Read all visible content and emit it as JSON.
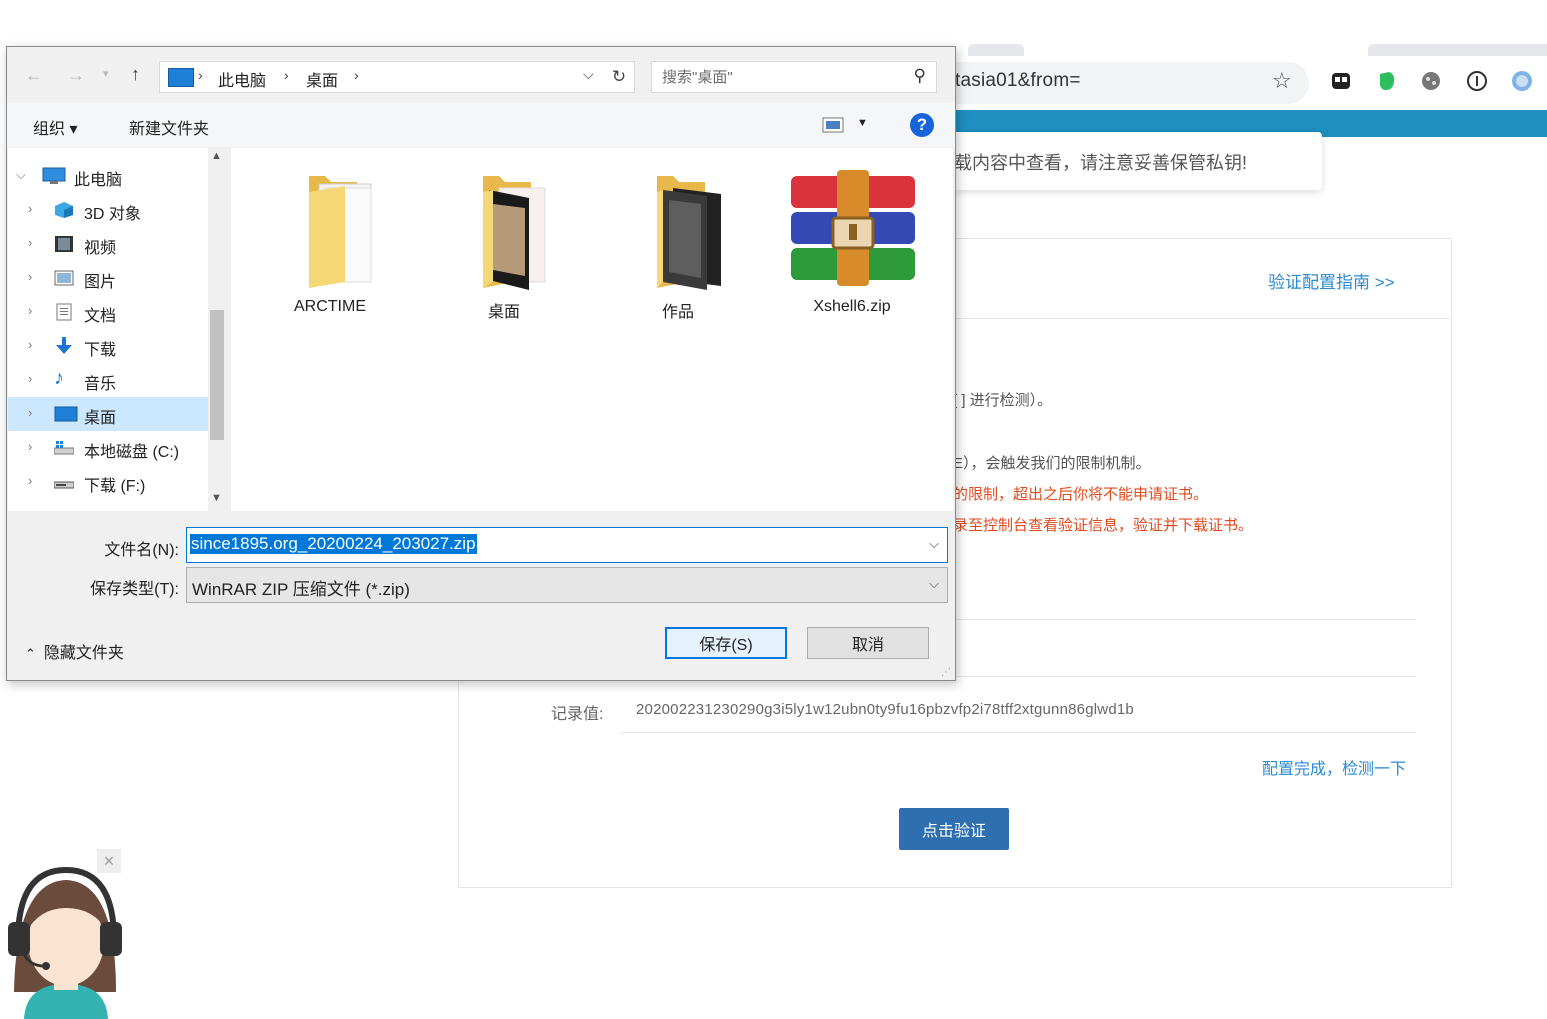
{
  "browser": {
    "url_fragment": "tasia01&from=",
    "toast": "下载内容中查看，请注意妥善保管私钥!",
    "guide_link": "验证配置指南 >>",
    "lines": [
      {
        "text": "[ ] 进行检测）。",
        "color": "#555555"
      },
      {
        "text": "E），会触发我们的限制机制。",
        "color": "#555555"
      },
      {
        "text": "的限制，超出之后你将不能申请证书。",
        "color": "#e04a1f"
      },
      {
        "text": "录至控制台查看验证信息，验证并下载证书。",
        "color": "#e04a1f"
      }
    ],
    "record_label": "记录值:",
    "record_value": "202002231230290g3i5ly1w12ubn0ty9fu16pbzvfp2i78tff2xtgunn86glwd1b",
    "done_link": "配置完成，检测一下",
    "verify_button": "点击验证"
  },
  "dialog": {
    "breadcrumb": [
      "此电脑",
      "桌面"
    ],
    "search_placeholder": "搜索\"桌面\"",
    "toolbar": {
      "organize": "组织 ▾",
      "new_folder": "新建文件夹"
    },
    "tree": [
      {
        "label": "此电脑",
        "icon": "computer-icon",
        "expanded": true
      },
      {
        "label": "3D 对象",
        "icon": "cube-3d-icon"
      },
      {
        "label": "视频",
        "icon": "video-icon"
      },
      {
        "label": "图片",
        "icon": "pictures-icon"
      },
      {
        "label": "文档",
        "icon": "document-icon"
      },
      {
        "label": "下载",
        "icon": "download-icon"
      },
      {
        "label": "音乐",
        "icon": "music-icon"
      },
      {
        "label": "桌面",
        "icon": "desktop-icon",
        "selected": true
      },
      {
        "label": "本地磁盘 (C:)",
        "icon": "drive-icon"
      },
      {
        "label": "下载 (F:)",
        "icon": "drive-icon"
      }
    ],
    "files": [
      {
        "name": "ARCTIME",
        "icon": "folder-icon"
      },
      {
        "name": "桌面",
        "icon": "folder-icon"
      },
      {
        "name": "作品",
        "icon": "folder-icon"
      },
      {
        "name": "Xshell6.zip",
        "icon": "winrar-archive-icon"
      }
    ],
    "filename_label": "文件名(N):",
    "filename_value": "since1895.org_20200224_203027.zip",
    "filetype_label": "保存类型(T):",
    "filetype_value": "WinRAR ZIP 压缩文件 (*.zip)",
    "hide_folders": "隐藏文件夹",
    "save_button": "保存(S)",
    "cancel_button": "取消"
  }
}
